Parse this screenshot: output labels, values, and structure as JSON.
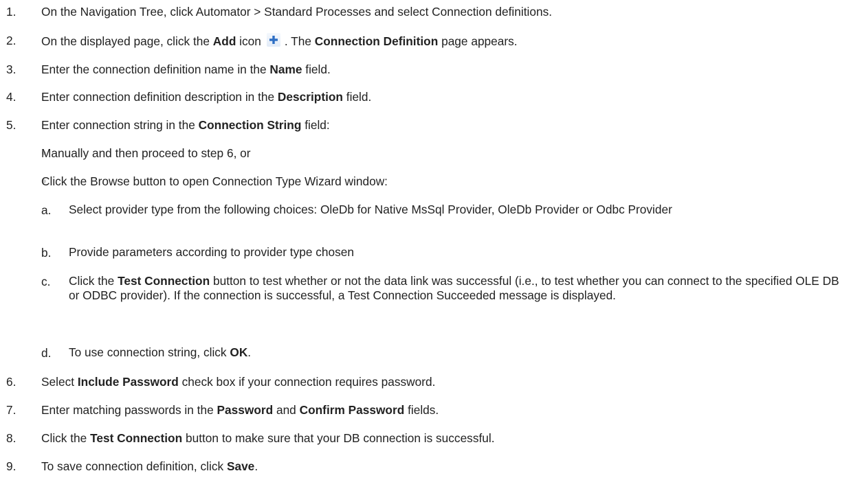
{
  "steps": [
    {
      "num": "1.",
      "text": "On the Navigation Tree, click Automator > Standard Processes and select Connection definitions."
    },
    {
      "num": "2.",
      "pre": "On the displayed page, click the ",
      "b1": "Add",
      "mid": " icon",
      "mid2": ". The ",
      "b2": "Connection Definition",
      "post": " page appears."
    },
    {
      "num": "3.",
      "pre": "Enter the connection definition name in the ",
      "b1": "Name",
      "post": " field."
    },
    {
      "num": "4.",
      "pre": "Enter connection definition description in the ",
      "b1": "Description",
      "post": " field."
    },
    {
      "num": "5.",
      "pre": "Enter connection string in the ",
      "b1": "Connection String",
      "post": " field:"
    },
    {
      "num": "6.",
      "pre": "Select ",
      "b1": "Include Password",
      "post": " check box if your connection requires password."
    },
    {
      "num": "7.",
      "pre": "Enter matching passwords in the ",
      "b1": "Password",
      "mid": " and ",
      "b2": "Confirm Password",
      "post": " fields."
    },
    {
      "num": "8.",
      "pre": "Click the ",
      "b1": "Test Connection",
      "post": " button to make sure that your DB connection is successful."
    },
    {
      "num": "9.",
      "pre": "To save connection definition, click ",
      "b1": "Save",
      "post": "."
    }
  ],
  "bullets": [
    "Manually and then proceed to step 6, or",
    "Click the Browse button to open Connection Type Wizard window:"
  ],
  "substeps": [
    {
      "letter": "a.",
      "text": "Select provider type from the following choices: OleDb for Native MsSql Provider, OleDb Provider or Odbc Provider"
    },
    {
      "letter": "b.",
      "text": "Provide parameters according to provider type chosen"
    },
    {
      "letter": "c.",
      "pre": "Click the ",
      "b1": "Test Connection",
      "post": " button to test whether or not the data link was successful (i.e., to test whether you can connect to the specified OLE DB or ODBC provider). If the connection is successful, a Test Connection Succeeded message is displayed."
    },
    {
      "letter": "d.",
      "pre": "To use connection string, click ",
      "b1": "OK",
      "post": "."
    }
  ],
  "icons": {
    "add_icon": "plus-icon",
    "add_icon_color": "#2e6fc4"
  }
}
